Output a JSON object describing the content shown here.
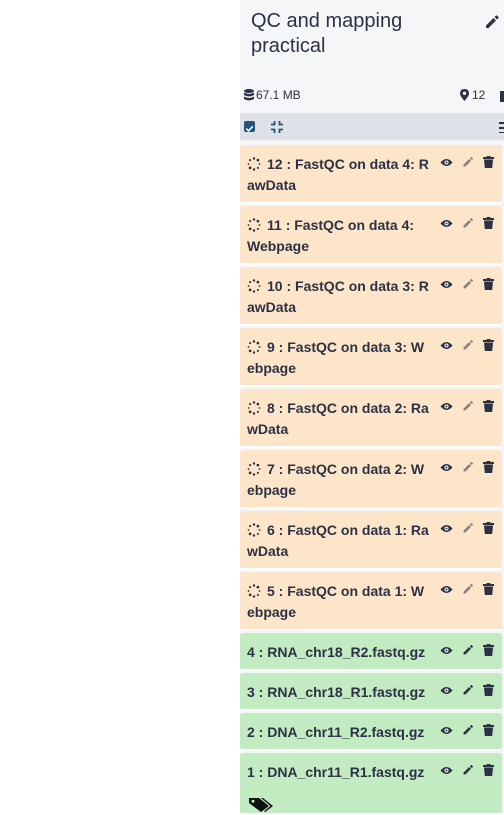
{
  "history": {
    "title": "QC and mapping practical",
    "size": "67.1 MB",
    "count": "12"
  },
  "items": [
    {
      "title": "12 : FastQC on data 4: RawData",
      "state": "queued"
    },
    {
      "title": "11 : FastQC on data 4: Webpage",
      "state": "queued"
    },
    {
      "title": "10 : FastQC on data 3: RawData",
      "state": "queued"
    },
    {
      "title": "9 : FastQC on data 3: Webpage",
      "state": "queued"
    },
    {
      "title": "8 : FastQC on data 2: RawData",
      "state": "queued"
    },
    {
      "title": "7 : FastQC on data 2: Webpage",
      "state": "queued"
    },
    {
      "title": "6 : FastQC on data 1: RawData",
      "state": "queued"
    },
    {
      "title": "5 : FastQC on data 1: Webpage",
      "state": "queued"
    },
    {
      "title": "4 : RNA_chr18_R2.fastq.gz",
      "state": "ok"
    },
    {
      "title": "3 : RNA_chr18_R1.fastq.gz",
      "state": "ok"
    },
    {
      "title": "2 : DNA_chr11_R2.fastq.gz",
      "state": "ok"
    },
    {
      "title": "1 : DNA_chr11_R1.fastq.gz",
      "state": "ok"
    }
  ],
  "icons": {
    "edit_title": "pencil-icon",
    "size": "database-icon",
    "count": "map-marker-icon",
    "select_all": "checkbox-icon",
    "collapse_all": "compress-icon",
    "view": "eye-icon",
    "edit": "pencil-icon",
    "delete": "trash-icon",
    "queued": "spinner-icon",
    "tags": "tags-icon"
  },
  "colors": {
    "queued_bg": "#fde5ca",
    "ok_bg": "#c2ebc2",
    "toolbar_bg": "#dee2e6",
    "panel_bg": "#f4f6f8",
    "text": "#2c3143"
  }
}
